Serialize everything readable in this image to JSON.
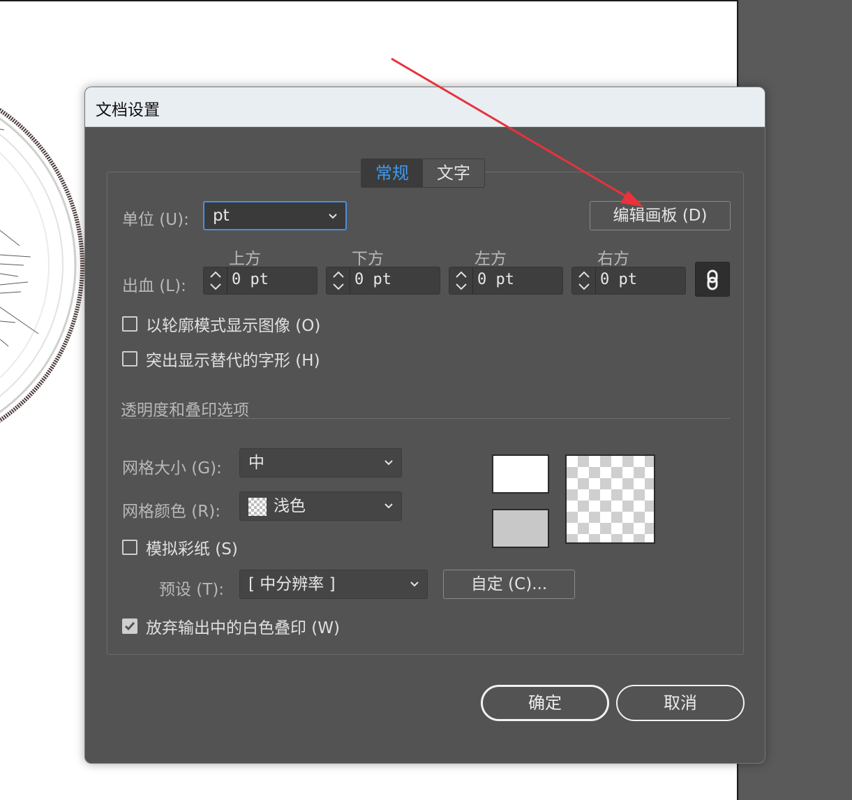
{
  "dialog": {
    "title": "文档设置",
    "tabs": [
      {
        "label": "常规",
        "active": true
      },
      {
        "label": "文字",
        "active": false
      }
    ],
    "units": {
      "label": "单位 (U):",
      "value": "pt"
    },
    "edit_artboards_button": "编辑画板 (D)",
    "bleed": {
      "label": "出血 (L):",
      "headers": [
        "上方",
        "下方",
        "左方",
        "右方"
      ],
      "values": [
        "0 pt",
        "0 pt",
        "0 pt",
        "0 pt"
      ],
      "link_icon": "link-icon"
    },
    "options": {
      "outline_mode": {
        "label": "以轮廓模式显示图像 (O)",
        "checked": false
      },
      "highlight_glyphs": {
        "label": "突出显示替代的字形 (H)",
        "checked": false
      }
    },
    "transparency": {
      "section_title": "透明度和叠印选项",
      "grid_size": {
        "label": "网格大小 (G):",
        "value": "中"
      },
      "grid_colors": {
        "label": "网格颜色 (R):",
        "value": "浅色"
      },
      "simulate_paper": {
        "label": "模拟彩纸 (S)",
        "checked": false
      },
      "preset": {
        "label": "预设 (T):",
        "value": "[ 中分辨率 ]"
      },
      "custom_button": "自定 (C)...",
      "discard_white_overprint": {
        "label": "放弃输出中的白色叠印 (W)",
        "checked": true
      },
      "swatch_colors": {
        "top": "#ffffff",
        "bottom": "#c8c8c8"
      }
    },
    "ok_button": "确定",
    "cancel_button": "取消"
  },
  "colors": {
    "accent": "#3e9af2",
    "dialog_bg": "#535353",
    "annotation_arrow": "#e8323c"
  }
}
